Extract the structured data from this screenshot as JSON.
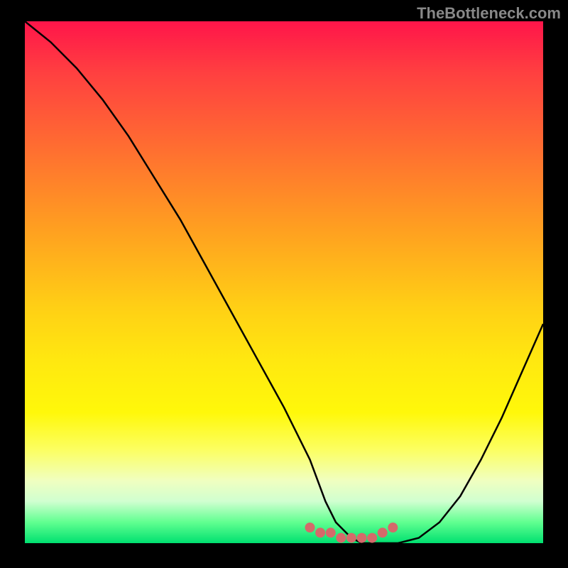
{
  "watermark": "TheBottleneck.com",
  "chart_data": {
    "type": "line",
    "title": "",
    "xlabel": "",
    "ylabel": "",
    "xlim": [
      0,
      100
    ],
    "ylim": [
      0,
      100
    ],
    "series": [
      {
        "name": "main-curve",
        "x": [
          0,
          5,
          10,
          15,
          20,
          25,
          30,
          35,
          40,
          45,
          50,
          55,
          58,
          60,
          63,
          65,
          68,
          72,
          76,
          80,
          84,
          88,
          92,
          96,
          100
        ],
        "values": [
          100,
          96,
          91,
          85,
          78,
          70,
          62,
          53,
          44,
          35,
          26,
          16,
          8,
          4,
          1,
          0,
          0,
          0,
          1,
          4,
          9,
          16,
          24,
          33,
          42
        ]
      },
      {
        "name": "dots-curve",
        "x": [
          55,
          57,
          59,
          61,
          63,
          65,
          67,
          69,
          71
        ],
        "values": [
          3,
          2,
          2,
          1,
          1,
          1,
          1,
          2,
          3
        ]
      }
    ],
    "colors": {
      "gradient_top": "#ff154a",
      "gradient_bottom": "#00e070",
      "background": "#000000",
      "curve": "#000000",
      "dots": "#d46a6a"
    }
  }
}
